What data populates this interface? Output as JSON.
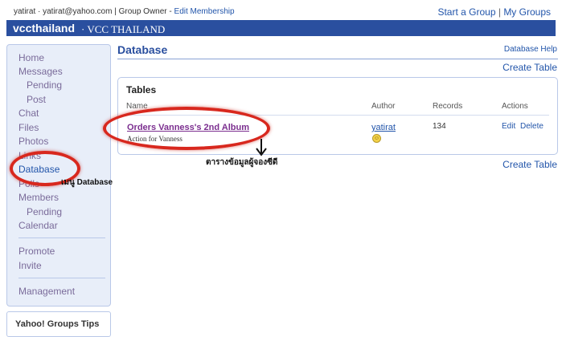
{
  "header": {
    "user_display": "yatirat",
    "user_email": "yatirat@yahoo.com",
    "role": "Group Owner",
    "edit_membership": "Edit Membership",
    "start_group": "Start a Group",
    "separator": "|",
    "my_groups": "My Groups"
  },
  "banner": {
    "group_name": "vccthailand",
    "group_title": "VCC THAILAND"
  },
  "sidebar": {
    "items": [
      {
        "label": "Home"
      },
      {
        "label": "Messages"
      },
      {
        "label": "Pending"
      },
      {
        "label": "Post"
      },
      {
        "label": "Chat"
      },
      {
        "label": "Files"
      },
      {
        "label": "Photos"
      },
      {
        "label": "Links"
      },
      {
        "label": "Database"
      },
      {
        "label": "Polls"
      },
      {
        "label": "Members"
      },
      {
        "label": "Pending"
      },
      {
        "label": "Calendar"
      },
      {
        "label": "Promote"
      },
      {
        "label": "Invite"
      },
      {
        "label": "Management"
      }
    ],
    "tips_title": "Yahoo! Groups Tips"
  },
  "main": {
    "title": "Database",
    "help_link": "Database Help",
    "create_table": "Create Table",
    "panel_title": "Tables",
    "columns": [
      "Name",
      "Author",
      "Records",
      "Actions"
    ],
    "rows": [
      {
        "name": "Orders Vanness's 2nd Album",
        "description": "Action for Vanness",
        "author": "yatirat",
        "records": "134",
        "edit": "Edit",
        "delete": "Delete"
      }
    ]
  },
  "annotations": {
    "menu_note": "เมนู Database",
    "table_note": "ตารางข้อมูลผู้จองซีดี"
  },
  "colors": {
    "banner_bg": "#2a4f9f",
    "link": "#2255aa",
    "table_name": "#7b2e8f",
    "highlight_ring": "#d8281e"
  }
}
